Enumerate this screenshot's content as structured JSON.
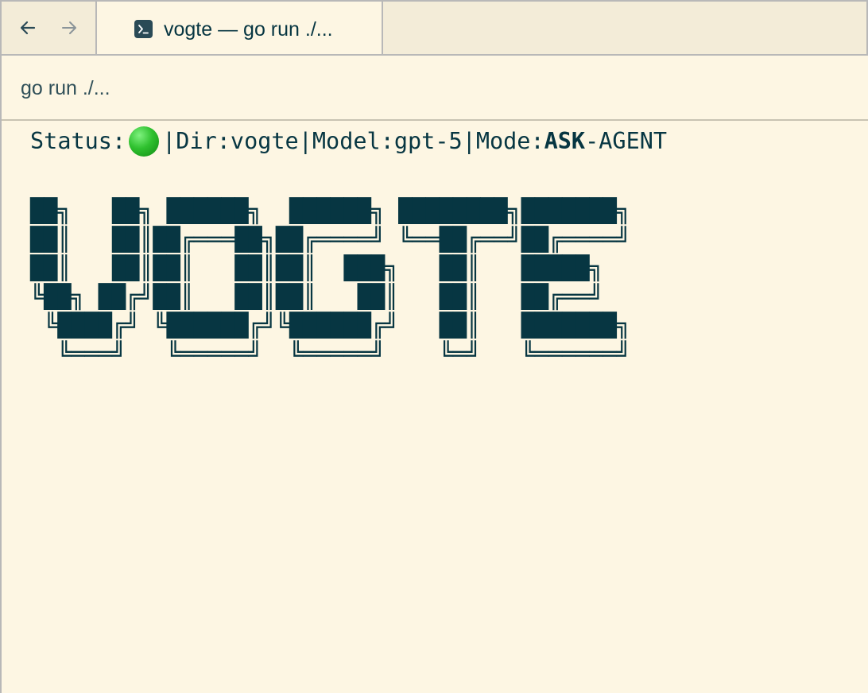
{
  "nav": {
    "back_icon": "arrow-left-icon",
    "forward_icon": "arrow-right-icon"
  },
  "tab": {
    "icon": "terminal-icon",
    "title": "vogte — go run ./..."
  },
  "subtitle": "go run ./...",
  "status": {
    "label": "Status:",
    "indicator_color": "#2fc12f",
    "separator": "|",
    "dir_label": "Dir:",
    "dir_value": "vogte",
    "model_label": "Model:",
    "model_value": "gpt-5",
    "mode_label": "Mode:",
    "mode_active": "ASK",
    "mode_dash": "-",
    "mode_other": "AGENT"
  },
  "logo_lines": [
    "██╗   ██╗ ██████╗  ██████╗ ████████╗███████╗",
    "██║   ██║██╔═══██╗██╔════╝ ╚══██╔══╝██╔════╝",
    "██║   ██║██║   ██║██║  ███╗   ██║   █████╗  ",
    "╚██╗ ██╔╝██║   ██║██║   ██║   ██║   ██╔══╝  ",
    " ╚████╔╝ ╚██████╔╝╚██████╔╝   ██║   ███████╗",
    "  ╚═══╝   ╚═════╝  ╚═════╝    ╚═╝   ╚══════╝"
  ],
  "colors": {
    "background": "#fdf6e3",
    "foreground": "#073642"
  }
}
